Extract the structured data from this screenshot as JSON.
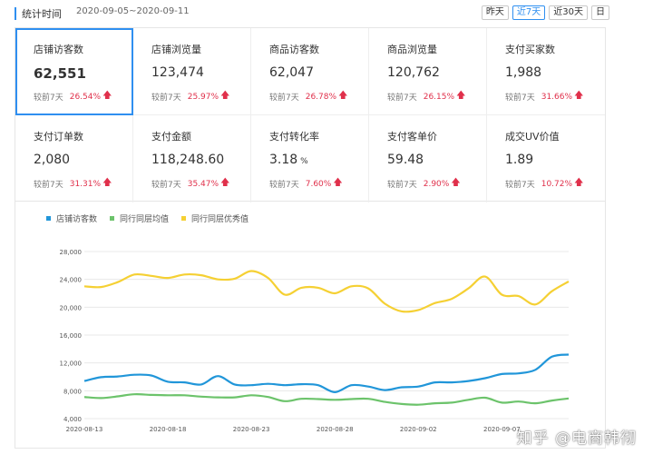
{
  "header": {
    "label": "统计时间",
    "date_range": "2020-09-05~2020-09-11",
    "buttons": [
      "昨天",
      "近7天",
      "近30天",
      "日"
    ],
    "active_button": 1
  },
  "metrics": [
    {
      "title": "店铺访客数",
      "value": "62,551",
      "compare_label": "较前7天",
      "change": "26.54%",
      "trend": "up",
      "selected": true
    },
    {
      "title": "店铺浏览量",
      "value": "123,474",
      "compare_label": "较前7天",
      "change": "25.97%",
      "trend": "up"
    },
    {
      "title": "商品访客数",
      "value": "62,047",
      "compare_label": "较前7天",
      "change": "26.78%",
      "trend": "up"
    },
    {
      "title": "商品浏览量",
      "value": "120,762",
      "compare_label": "较前7天",
      "change": "26.15%",
      "trend": "up"
    },
    {
      "title": "支付买家数",
      "value": "1,988",
      "compare_label": "较前7天",
      "change": "31.66%",
      "trend": "up"
    },
    {
      "title": "支付订单数",
      "value": "2,080",
      "compare_label": "较前7天",
      "change": "31.31%",
      "trend": "up"
    },
    {
      "title": "支付金额",
      "value": "118,248.60",
      "compare_label": "较前7天",
      "change": "35.47%",
      "trend": "up"
    },
    {
      "title": "支付转化率",
      "value": "3.18",
      "unit": "%",
      "compare_label": "较前7天",
      "change": "7.60%",
      "trend": "up"
    },
    {
      "title": "支付客单价",
      "value": "59.48",
      "compare_label": "较前7天",
      "change": "2.90%",
      "trend": "up"
    },
    {
      "title": "成交UV价值",
      "value": "1.89",
      "compare_label": "较前7天",
      "change": "10.72%",
      "trend": "up"
    }
  ],
  "colors": {
    "accent": "#2f8ff0",
    "up": "#e0304b",
    "series_visitors": "#2196d9",
    "series_peer_avg": "#6cc36b",
    "series_peer_excellent": "#f5d033"
  },
  "watermark": "知乎 @电商韩彻",
  "chart_data": {
    "type": "line",
    "x": [
      "2020-08-13",
      "2020-08-14",
      "2020-08-15",
      "2020-08-16",
      "2020-08-17",
      "2020-08-18",
      "2020-08-19",
      "2020-08-20",
      "2020-08-21",
      "2020-08-22",
      "2020-08-23",
      "2020-08-24",
      "2020-08-25",
      "2020-08-26",
      "2020-08-27",
      "2020-08-28",
      "2020-08-29",
      "2020-08-30",
      "2020-08-31",
      "2020-09-01",
      "2020-09-02",
      "2020-09-03",
      "2020-09-04",
      "2020-09-05",
      "2020-09-06",
      "2020-09-07",
      "2020-09-08",
      "2020-09-09",
      "2020-09-10",
      "2020-09-11"
    ],
    "x_tick_labels": [
      "2020-08-13",
      "2020-08-18",
      "2020-08-23",
      "2020-08-28",
      "2020-09-02",
      "2020-09-07"
    ],
    "y_ticks": [
      4000,
      8000,
      12000,
      16000,
      20000,
      24000,
      28000
    ],
    "y_tick_labels": [
      "4,000",
      "8,000",
      "12,000",
      "16,000",
      "20,000",
      "24,000",
      "28,000"
    ],
    "ylim": [
      4000,
      28000
    ],
    "grid": true,
    "legend_position": "top-left",
    "series": [
      {
        "name": "店铺访客数",
        "color": "#2196d9",
        "values": [
          9400,
          9950,
          10050,
          10300,
          10200,
          9300,
          9200,
          8900,
          10100,
          8900,
          8800,
          9000,
          8800,
          8950,
          8800,
          7800,
          8800,
          8600,
          8100,
          8500,
          8600,
          9200,
          9200,
          9400,
          9800,
          10400,
          10500,
          11000,
          12900,
          13200
        ]
      },
      {
        "name": "同行同层均值",
        "color": "#6cc36b",
        "values": [
          7100,
          6950,
          7200,
          7500,
          7400,
          7350,
          7350,
          7150,
          7050,
          7050,
          7350,
          7100,
          6500,
          6850,
          6800,
          6700,
          6800,
          6850,
          6400,
          6100,
          6000,
          6200,
          6300,
          6700,
          7000,
          6300,
          6450,
          6200,
          6600,
          6900
        ]
      },
      {
        "name": "同行同层优秀值",
        "color": "#f5d033",
        "values": [
          23000,
          22900,
          23600,
          24700,
          24500,
          24200,
          24700,
          24600,
          24000,
          24100,
          25200,
          24200,
          21800,
          22800,
          22800,
          22000,
          23000,
          22700,
          20500,
          19400,
          19600,
          20600,
          21200,
          22700,
          24400,
          21800,
          21600,
          20400,
          22300,
          23700
        ]
      }
    ]
  }
}
